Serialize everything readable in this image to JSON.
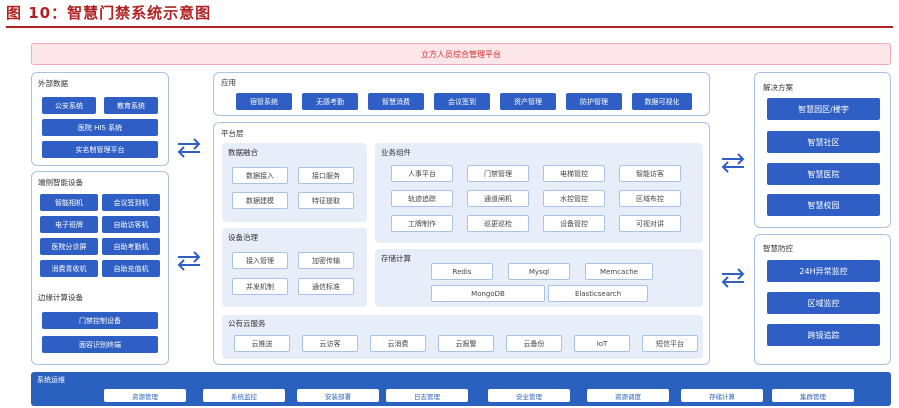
{
  "figure_title": "图 10：智慧门禁系统示意图",
  "platform_banner": "立方人员综合管理平台",
  "external_data": {
    "title": "外部数据",
    "items": [
      "公安系统",
      "教育系统",
      "医院 HIS 系统",
      "实名制管理平台"
    ]
  },
  "smart_devices": {
    "title": "端侧智能设备",
    "items": [
      "智能相机",
      "会议签到机",
      "电子班牌",
      "自助访客机",
      "医院分诊屏",
      "自助考勤机",
      "消费青收机",
      "自助充值机"
    ]
  },
  "edge_devices": {
    "title": "边缘计算设备",
    "items": [
      "门禁控制设备",
      "面容识别终端"
    ]
  },
  "apps": {
    "title": "应用",
    "items": [
      "宿管系统",
      "无感考勤",
      "智慧消费",
      "会议签到",
      "资产管理",
      "防护管理",
      "数据可视化"
    ]
  },
  "platform_layer": {
    "title": "平台层"
  },
  "data_fusion": {
    "title": "数据融合",
    "items": [
      "数据接入",
      "接口服务",
      "数据建模",
      "特征提取"
    ]
  },
  "device_governance": {
    "title": "设备治理",
    "items": [
      "接入管理",
      "加密传输",
      "并发机制",
      "通信标准"
    ]
  },
  "business": {
    "title": "业务组件",
    "items": [
      "人事平台",
      "门禁管理",
      "电梯管控",
      "智能访客",
      "轨迹追踪",
      "通道闸机",
      "水控管控",
      "区域布控",
      "工牌制作",
      "巡更巡检",
      "设备管控",
      "可视对讲"
    ]
  },
  "storage": {
    "title": "存储计算",
    "items": [
      "Redis",
      "Mysql",
      "Memcache",
      "MongoDB",
      "Elasticsearch"
    ]
  },
  "public_cloud": {
    "title": "公有云服务",
    "items": [
      "云推送",
      "云访客",
      "云消费",
      "云报警",
      "云备份",
      "IoT",
      "短信平台"
    ]
  },
  "solutions": {
    "title": "解决方案",
    "items": [
      "智慧园区/楼宇",
      "智慧社区",
      "智慧医院",
      "智慧校园"
    ]
  },
  "security": {
    "title": "智慧防控",
    "items": [
      "24H异常监控",
      "区域监控",
      "跨镜追踪"
    ]
  },
  "ops": {
    "title": "系统运维",
    "items": [
      "资源管理",
      "系统监控",
      "安装部署",
      "日志管理",
      "安全管理",
      "资源调度",
      "存储计算",
      "集群管理"
    ]
  },
  "colors": {
    "title_red": "#b22222",
    "primary_blue": "#2f5fc4",
    "panel_border": "#a9c2e6",
    "sub_bg": "#e7eef9",
    "banner_pink": "#fde6ea"
  }
}
